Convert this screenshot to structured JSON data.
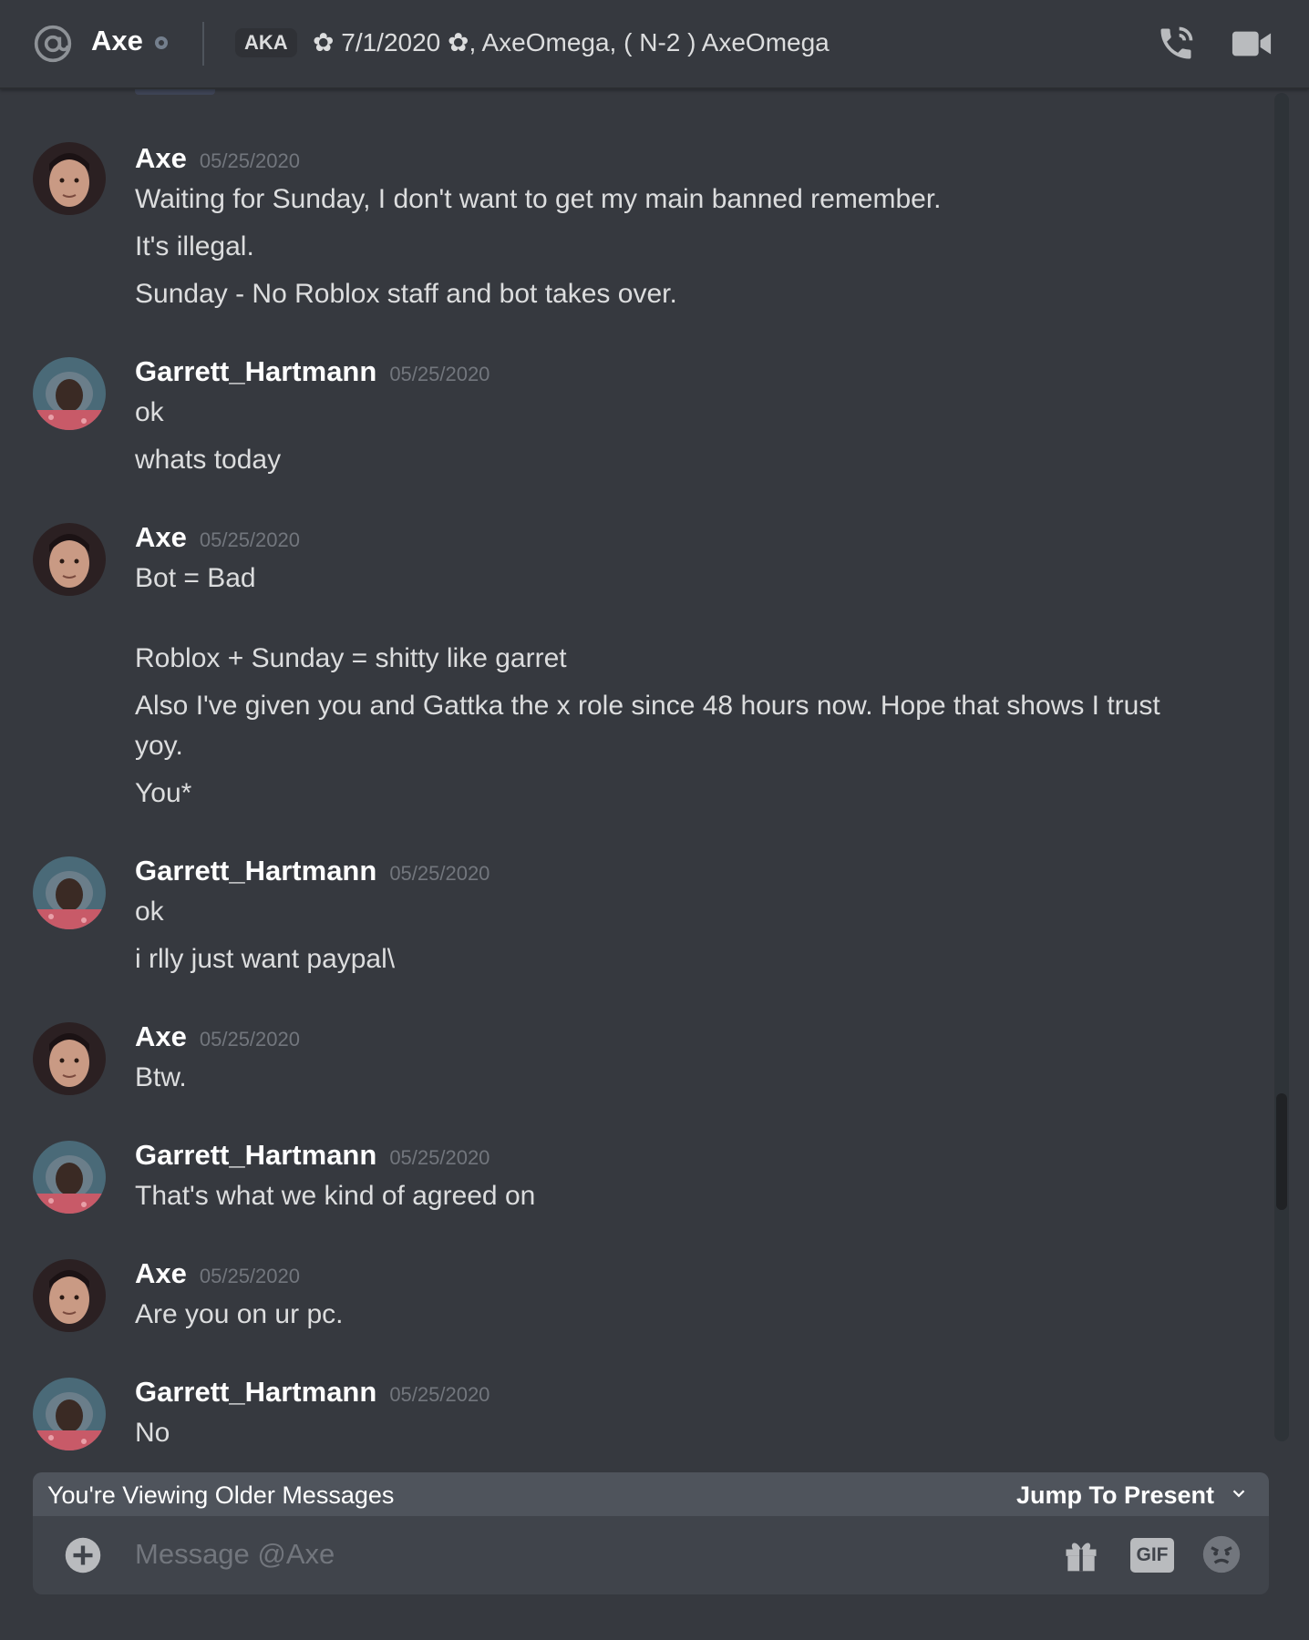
{
  "header": {
    "username": "Axe",
    "aka_label": "AKA",
    "nicknames": "✿ 7/1/2020 ✿, AxeOmega, ( N-2 ) AxeOmega"
  },
  "messages": [
    {
      "author": "Axe",
      "timestamp": "05/25/2020",
      "lines": [
        "Waiting for Sunday, I don't want to get my main banned remember.",
        "It's illegal.",
        "Sunday - No Roblox staff and bot takes over."
      ]
    },
    {
      "author": "Garrett_Hartmann",
      "timestamp": "05/25/2020",
      "lines": [
        "ok",
        "whats today"
      ]
    },
    {
      "author": "Axe",
      "timestamp": "05/25/2020",
      "lines": [
        "Bot = Bad",
        "Roblox + Sunday = shitty like garret",
        "Also I've given you and Gattka the x role since 48 hours now. Hope that shows I trust",
        "yoy.",
        "You*"
      ]
    },
    {
      "author": "Garrett_Hartmann",
      "timestamp": "05/25/2020",
      "lines": [
        "ok",
        "i rlly just want paypal\\"
      ]
    },
    {
      "author": "Axe",
      "timestamp": "05/25/2020",
      "lines": [
        "Btw."
      ]
    },
    {
      "author": "Garrett_Hartmann",
      "timestamp": "05/25/2020",
      "lines": [
        "That's what we kind of agreed on"
      ]
    },
    {
      "author": "Axe",
      "timestamp": "05/25/2020",
      "lines": [
        "Are you on ur pc."
      ]
    },
    {
      "author": "Garrett_Hartmann",
      "timestamp": "05/25/2020",
      "lines": [
        "No"
      ]
    }
  ],
  "older_banner": {
    "label": "You're Viewing Older Messages",
    "jump": "Jump To Present"
  },
  "composer": {
    "placeholder": "Message @Axe",
    "gif_label": "GIF"
  }
}
